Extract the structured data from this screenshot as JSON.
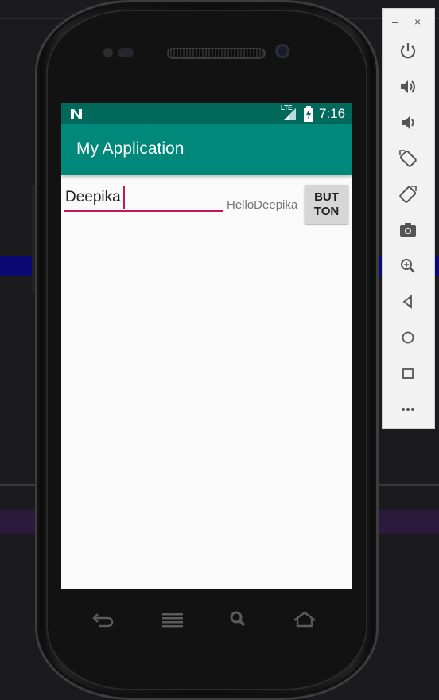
{
  "status_bar": {
    "time": "7:16",
    "network_label": "LTE"
  },
  "app_bar": {
    "title": "My Application"
  },
  "content": {
    "edit_value": "Deepika",
    "output_text": "HelloDeepika",
    "button_label": "BUTTON"
  },
  "toolbar": {
    "minimize": "–",
    "close": "×",
    "buttons": [
      "power-icon",
      "volume-up-icon",
      "volume-down-icon",
      "rotate-left-icon",
      "rotate-right-icon",
      "camera-icon",
      "zoom-icon",
      "back-icon",
      "home-icon",
      "overview-icon",
      "more-icon"
    ]
  },
  "colors": {
    "status_bar": "#00695c",
    "app_bar": "#00897b",
    "accent": "#c2185b"
  }
}
